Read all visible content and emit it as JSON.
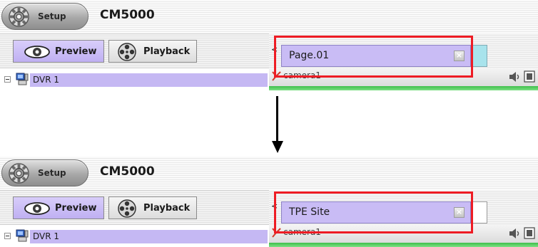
{
  "colors": {
    "highlight": "#ee1c24",
    "selected_purple": "#c9bcf5",
    "status_green": "#3fbf4a",
    "next_tab_before": "#a8e3ec",
    "next_tab_after": "#ffffff"
  },
  "icons": {
    "setup": "gear-icon",
    "preview": "eye-icon",
    "playback": "film-reel-icon",
    "dvr": "dvr-computer-icon",
    "camera": "camera-marker-icon",
    "audio": "speaker-icon",
    "video": "film-icon",
    "tab_close": "close-icon",
    "transition": "arrow-down-icon"
  },
  "before": {
    "setup_label": "Setup",
    "app_title": "CM5000",
    "preview_label": "Preview",
    "playback_label": "Playback",
    "tree_item": "DVR 1",
    "scroll_glyph": "<",
    "page_tab_label": "Page.01",
    "close_glyph": "×",
    "camera_label": "camera1"
  },
  "after": {
    "setup_label": "Setup",
    "app_title": "CM5000",
    "preview_label": "Preview",
    "playback_label": "Playback",
    "tree_item": "DVR 1",
    "scroll_glyph": "<",
    "page_tab_label": "TPE Site",
    "close_glyph": "×",
    "camera_label": "camera1"
  }
}
